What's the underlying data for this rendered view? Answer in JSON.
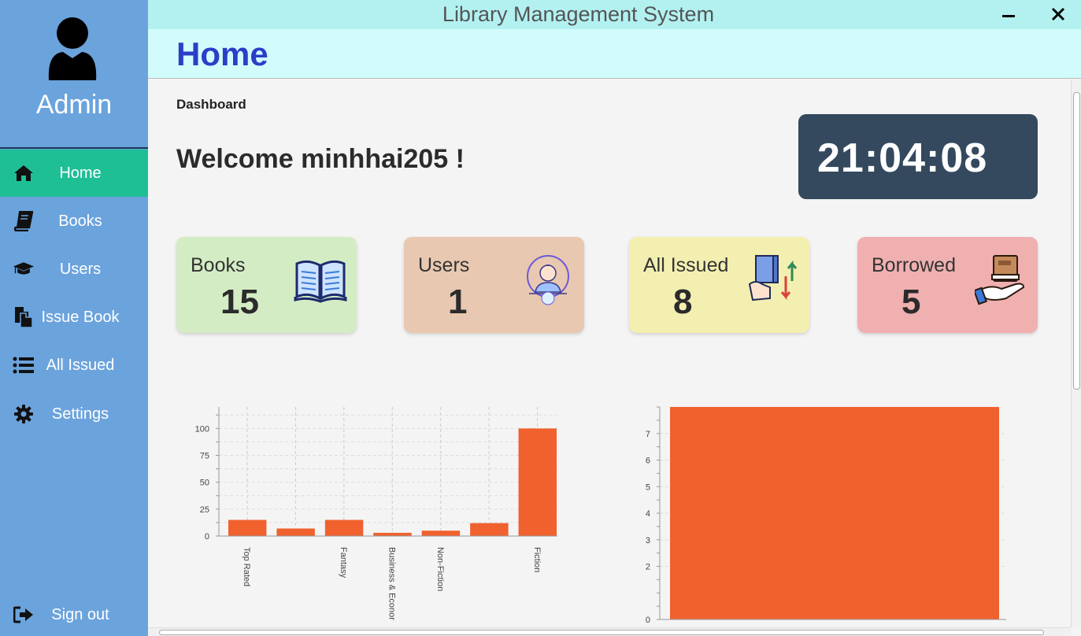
{
  "window": {
    "title": "Library Management System"
  },
  "sidebar": {
    "user_label": "Admin",
    "items": [
      {
        "label": "Home",
        "icon": "home-icon",
        "active": true
      },
      {
        "label": "Books",
        "icon": "book-icon",
        "active": false
      },
      {
        "label": "Users",
        "icon": "graduation-cap-icon",
        "active": false
      },
      {
        "label": "Issue Book",
        "icon": "copy-icon",
        "active": false
      },
      {
        "label": "All Issued",
        "icon": "list-icon",
        "active": false
      },
      {
        "label": "Settings",
        "icon": "gear-icon",
        "active": false
      }
    ],
    "signout_label": "Sign out"
  },
  "header": {
    "title": "Home"
  },
  "main": {
    "section_label": "Dashboard",
    "welcome_prefix": "Welcome ",
    "username": "minhhai205",
    "welcome_suffix": " !",
    "clock": "21:04:08",
    "cards": [
      {
        "title": "Books",
        "value": "15",
        "color": "#d4ecc4",
        "icon": "open-book-icon"
      },
      {
        "title": "Users",
        "value": "1",
        "color": "#e8c8b0",
        "icon": "user-avatar-icon"
      },
      {
        "title": "All Issued",
        "value": "8",
        "color": "#f3efb0",
        "icon": "book-exchange-icon"
      },
      {
        "title": "Borrowed",
        "value": "5",
        "color": "#f0b0b0",
        "icon": "hand-book-icon"
      }
    ]
  },
  "colors": {
    "accent_bar": "#f0612e",
    "sidebar": "#6ba3dc",
    "active_nav": "#1fbf96"
  },
  "chart_data": [
    {
      "type": "bar",
      "categories": [
        "Top Rated",
        "",
        "Fantasy",
        "Business & Econor",
        "Non-Fiction",
        "",
        "Fiction"
      ],
      "values": [
        15,
        7,
        15,
        3,
        5,
        12,
        100
      ],
      "xlabel": "",
      "ylabel": "",
      "ylim": [
        0,
        120
      ],
      "yticks": [
        0,
        25,
        50,
        75,
        100
      ],
      "grid": true
    },
    {
      "type": "bar",
      "categories": [
        ""
      ],
      "values": [
        8
      ],
      "xlabel": "",
      "ylabel": "",
      "ylim": [
        0,
        8
      ],
      "yticks": [
        0,
        2,
        3,
        4,
        5,
        6,
        7
      ],
      "grid": true
    }
  ]
}
